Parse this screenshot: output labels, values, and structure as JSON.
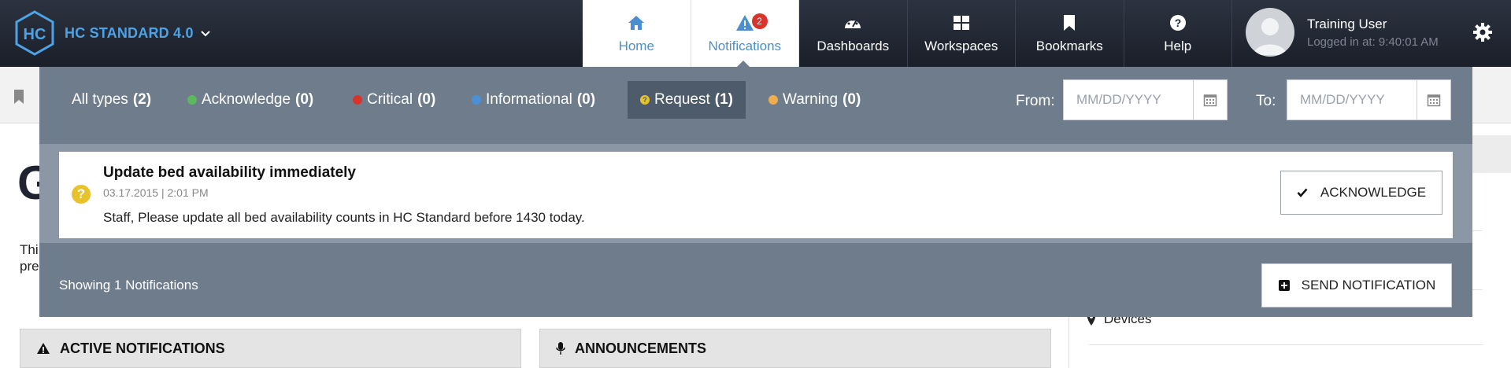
{
  "brand": {
    "name": "HC STANDARD 4.0",
    "logo_text": "HC"
  },
  "nav": {
    "tabs": [
      {
        "label": "Home",
        "icon": "home-icon"
      },
      {
        "label": "Notifications",
        "icon": "alert-icon",
        "badge": "2"
      },
      {
        "label": "Dashboards",
        "icon": "dashboard-icon"
      },
      {
        "label": "Workspaces",
        "icon": "workspaces-icon"
      },
      {
        "label": "Bookmarks",
        "icon": "bookmark-icon"
      },
      {
        "label": "Help",
        "icon": "help-icon"
      }
    ]
  },
  "user": {
    "name": "Training User",
    "login": "Logged in at: 9:40:01 AM"
  },
  "background": {
    "big_letter": "G",
    "text_line1": "Thi",
    "text_line2": "pre",
    "devices_label": "Devices",
    "active_notifications": "ACTIVE NOTIFICATIONS",
    "announcements": "ANNOUNCEMENTS"
  },
  "notifications": {
    "filters": [
      {
        "label": "All types",
        "count": "(2)",
        "color": ""
      },
      {
        "label": "Acknowledge",
        "count": "(0)",
        "color": "#5cb85c"
      },
      {
        "label": "Critical",
        "count": "(0)",
        "color": "#d9342b"
      },
      {
        "label": "Informational",
        "count": "(0)",
        "color": "#4a90d9"
      },
      {
        "label": "Request",
        "count": "(1)",
        "color": "#e8c22b"
      },
      {
        "label": "Warning",
        "count": "(0)",
        "color": "#f0ad4e"
      }
    ],
    "from_label": "From:",
    "to_label": "To:",
    "date_placeholder": "MM/DD/YYYY",
    "items": [
      {
        "title": "Update bed availability immediately",
        "date": "03.17.2015 | 2:01 PM",
        "body": "Staff, Please update all bed availability counts in HC Standard before 1430 today.",
        "type_color": "#e8c22b",
        "type_icon": "?",
        "action_label": "ACKNOWLEDGE"
      }
    ],
    "showing_text": "Showing 1 Notifications",
    "send_label": "SEND NOTIFICATION"
  }
}
